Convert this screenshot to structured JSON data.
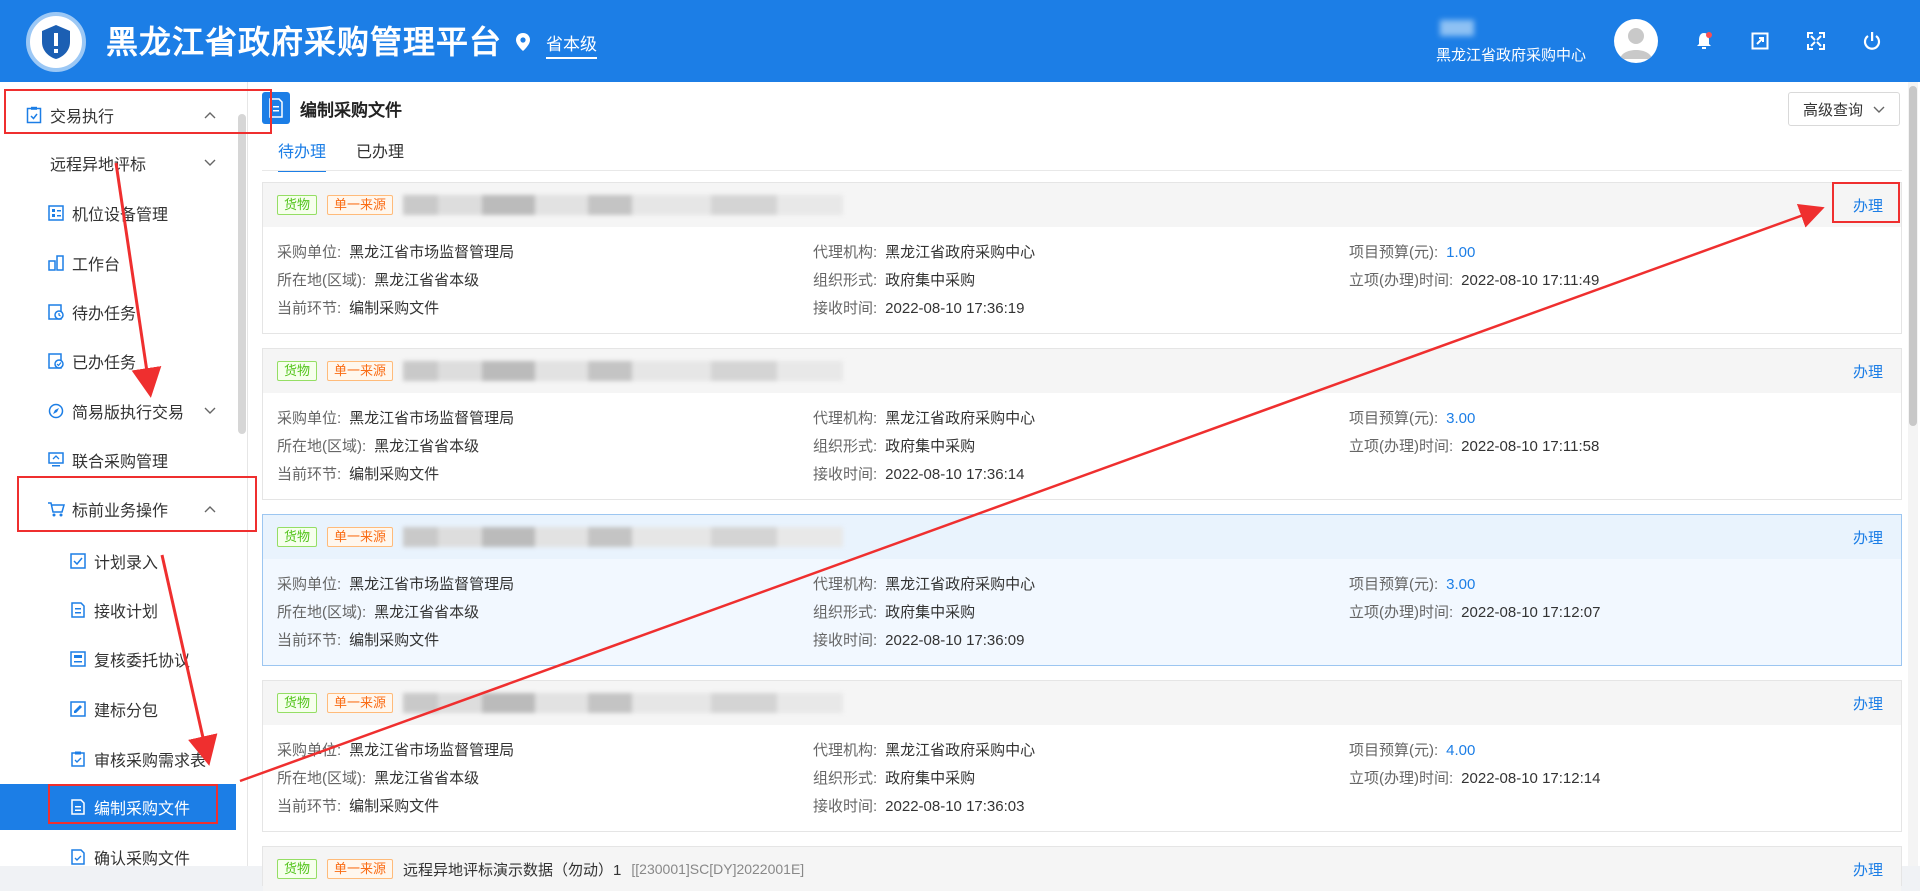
{
  "header": {
    "title": "黑龙江省政府采购管理平台",
    "region": "省本级",
    "user_org": "黑龙江省政府采购中心"
  },
  "sidebar": {
    "items": [
      {
        "label": "交易执行"
      },
      {
        "label": "远程异地评标"
      },
      {
        "label": "机位设备管理"
      },
      {
        "label": "工作台"
      },
      {
        "label": "待办任务"
      },
      {
        "label": "已办任务"
      },
      {
        "label": "简易版执行交易"
      },
      {
        "label": "联合采购管理"
      },
      {
        "label": "标前业务操作"
      },
      {
        "label": "计划录入"
      },
      {
        "label": "接收计划"
      },
      {
        "label": "复核委托协议"
      },
      {
        "label": "建标分包"
      },
      {
        "label": "审核采购需求表"
      },
      {
        "label": "编制采购文件"
      },
      {
        "label": "确认采购文件"
      }
    ]
  },
  "main": {
    "page_title": "编制采购文件",
    "advanced_query": "高级查询",
    "tabs": [
      "待办理",
      "已办理"
    ],
    "field_labels": {
      "purchaser": "采购单位:",
      "location": "所在地(区域):",
      "current_step": "当前环节:",
      "agency": "代理机构:",
      "form": "组织形式:",
      "received": "接收时间:",
      "budget": "项目预算(元):",
      "approved": "立项(办理)时间:"
    },
    "action_label": "办理",
    "cards": [
      {
        "tag_type": "货物",
        "tag_method": "单一来源",
        "purchaser": "黑龙江省市场监督管理局",
        "location": "黑龙江省省本级",
        "current_step": "编制采购文件",
        "agency": "黑龙江省政府采购中心",
        "form": "政府集中采购",
        "received": "2022-08-10 17:36:19",
        "budget": "1.00",
        "approved": "2022-08-10 17:11:49"
      },
      {
        "tag_type": "货物",
        "tag_method": "单一来源",
        "purchaser": "黑龙江省市场监督管理局",
        "location": "黑龙江省省本级",
        "current_step": "编制采购文件",
        "agency": "黑龙江省政府采购中心",
        "form": "政府集中采购",
        "received": "2022-08-10 17:36:14",
        "budget": "3.00",
        "approved": "2022-08-10 17:11:58"
      },
      {
        "tag_type": "货物",
        "tag_method": "单一来源",
        "purchaser": "黑龙江省市场监督管理局",
        "location": "黑龙江省省本级",
        "current_step": "编制采购文件",
        "agency": "黑龙江省政府采购中心",
        "form": "政府集中采购",
        "received": "2022-08-10 17:36:09",
        "budget": "3.00",
        "approved": "2022-08-10 17:12:07"
      },
      {
        "tag_type": "货物",
        "tag_method": "单一来源",
        "purchaser": "黑龙江省市场监督管理局",
        "location": "黑龙江省省本级",
        "current_step": "编制采购文件",
        "agency": "黑龙江省政府采购中心",
        "form": "政府集中采购",
        "received": "2022-08-10 17:36:03",
        "budget": "4.00",
        "approved": "2022-08-10 17:12:14"
      }
    ],
    "partial_card": {
      "tag_type": "货物",
      "tag_method": "单一来源",
      "title": "远程异地评标演示数据（勿动）1",
      "code": "[[230001]SC[DY]2022001E]",
      "action": "办理"
    }
  },
  "colors": {
    "brand": "#1c7ee6",
    "annotation": "#ef2f2f",
    "tag_goods": "#52c41a",
    "tag_method": "#fa6c14"
  }
}
